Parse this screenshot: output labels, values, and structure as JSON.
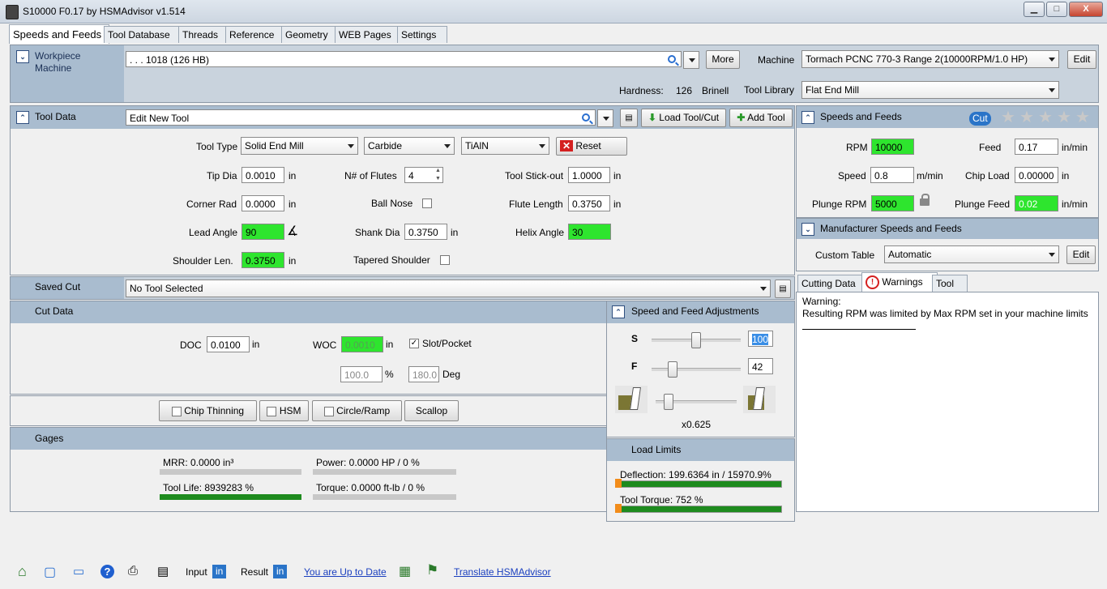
{
  "window": {
    "title": "S10000 F0.17 by HSMAdvisor v1.514",
    "min": "▁",
    "max": "□",
    "close": "X"
  },
  "tabs": [
    "Speeds and Feeds",
    "Tool Database",
    "Threads",
    "Reference",
    "Geometry",
    "WEB Pages",
    "Settings"
  ],
  "workpiece": {
    "header_line1": "Workpiece",
    "header_line2": "Machine",
    "material": ". . . 1018 (126 HB)",
    "more": "More",
    "machine_label": "Machine",
    "machine": "Tormach PCNC 770-3 Range 2(10000RPM/1.0 HP)",
    "edit": "Edit",
    "hardness_label": "Hardness:",
    "hardness_value": "126",
    "hardness_unit": "Brinell",
    "tool_library_label": "Tool Library",
    "tool_library": "Flat End Mill"
  },
  "tool_data": {
    "header": "Tool Data",
    "tool_name": "Edit New Tool",
    "load": "Load Tool/Cut",
    "add": "Add Tool",
    "tool_type_label": "Tool Type",
    "tool_type": "Solid End Mill",
    "material": "Carbide",
    "coating": "TiAlN",
    "reset": "Reset",
    "tip_dia_label": "Tip Dia",
    "tip_dia": "0.0010",
    "flutes_label": "N# of Flutes",
    "flutes": "4",
    "stickout_label": "Tool Stick-out",
    "stickout": "1.0000",
    "corner_rad_label": "Corner Rad",
    "corner_rad": "0.0000",
    "ball_nose_label": "Ball Nose",
    "flute_len_label": "Flute Length",
    "flute_len": "0.3750",
    "lead_angle_label": "Lead Angle",
    "lead_angle": "90",
    "shank_dia_label": "Shank Dia",
    "shank_dia": "0.3750",
    "helix_label": "Helix Angle",
    "helix": "30",
    "shoulder_label": "Shoulder Len.",
    "shoulder": "0.3750",
    "tapered_label": "Tapered Shoulder",
    "unit": "in"
  },
  "saved_cut": {
    "label": "Saved Cut",
    "value": "No Tool Selected"
  },
  "cut_data": {
    "header": "Cut Data",
    "doc_label": "DOC",
    "doc": "0.0100",
    "woc_label": "WOC",
    "woc": "0.0010",
    "slot_label": "Slot/Pocket",
    "pct": "100.0",
    "pct_unit": "%",
    "deg": "180.0",
    "deg_unit": "Deg",
    "unit": "in"
  },
  "options": {
    "chip_thinning": "Chip Thinning",
    "hsm": "HSM",
    "circle": "Circle/Ramp",
    "scallop": "Scallop"
  },
  "gages": {
    "header": "Gages",
    "mrr": "MRR: 0.0000 in³",
    "power": "Power: 0.0000 HP / 0 %",
    "tool_life": "Tool Life: 8939283 %",
    "torque": "Torque: 0.0000 ft-lb / 0 %",
    "tool_life_level": 1.0,
    "mrr_level": 0.0,
    "power_level": 0.0,
    "torque_level": 0.0
  },
  "sf": {
    "header": "Speeds and Feeds",
    "cut_badge": "Cut",
    "rpm_label": "RPM",
    "rpm": "10000",
    "feed_label": "Feed",
    "feed": "0.17",
    "feed_unit": "in/min",
    "speed_label": "Speed",
    "speed": "0.8",
    "speed_unit": "m/min",
    "chip_label": "Chip Load",
    "chip": "0.00000",
    "chip_unit": "in",
    "plunge_rpm_label": "Plunge RPM",
    "plunge_rpm": "5000",
    "plunge_feed_label": "Plunge Feed",
    "plunge_feed": "0.02",
    "plunge_unit": "in/min"
  },
  "mfr": {
    "header": "Manufacturer Speeds and Feeds",
    "custom_label": "Custom Table",
    "custom": "Automatic",
    "edit": "Edit"
  },
  "info_tabs": [
    "Cutting Data",
    "Warnings",
    "Tool"
  ],
  "warnings": {
    "line1": "Warning:",
    "line2": "Resulting RPM was limited by Max RPM set in your machine limits"
  },
  "adj": {
    "header": "Speed and Feed Adjustments",
    "s_label": "S",
    "s_value": "100",
    "f_label": "F",
    "f_value": "42",
    "engagement": "x0.625"
  },
  "limits": {
    "header": "Load Limits",
    "deflection": "Deflection: 199.6364 in / 15970.9%",
    "torque": "Tool Torque: 752 %",
    "deflection_level": 1.0,
    "torque_level": 1.0
  },
  "status": {
    "input_label": "Input",
    "input_unit": "in",
    "result_label": "Result",
    "result_unit": "in",
    "uptodate": "You are Up to Date",
    "translate": "Translate HSMAdvisor"
  },
  "colors": {
    "highlight": "#2ee52e",
    "header": "#a9bccf",
    "gauge": "#1e8b1e",
    "accent": "#2a74c8"
  }
}
